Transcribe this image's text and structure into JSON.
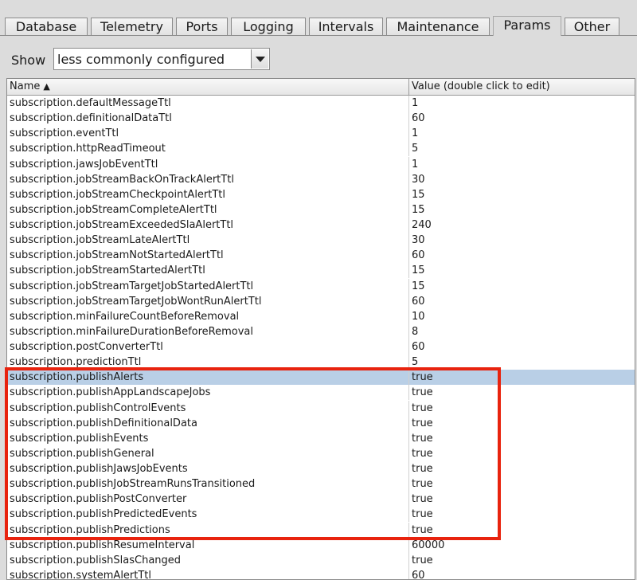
{
  "tabs": [
    {
      "label": "Database"
    },
    {
      "label": "Telemetry"
    },
    {
      "label": "Ports"
    },
    {
      "label": "Logging"
    },
    {
      "label": "Intervals"
    },
    {
      "label": "Maintenance"
    },
    {
      "label": "Params"
    },
    {
      "label": "Other"
    }
  ],
  "active_tab": "Params",
  "show": {
    "label": "Show",
    "selected": "less commonly configured"
  },
  "table": {
    "columns": {
      "name": "Name",
      "sort_indicator": "▲",
      "value": "Value (double click to edit)"
    },
    "rows": [
      {
        "name": "subscription.defaultMessageTtl",
        "value": "1"
      },
      {
        "name": "subscription.definitionalDataTtl",
        "value": "60"
      },
      {
        "name": "subscription.eventTtl",
        "value": "1"
      },
      {
        "name": "subscription.httpReadTimeout",
        "value": "5"
      },
      {
        "name": "subscription.jawsJobEventTtl",
        "value": "1"
      },
      {
        "name": "subscription.jobStreamBackOnTrackAlertTtl",
        "value": "30"
      },
      {
        "name": "subscription.jobStreamCheckpointAlertTtl",
        "value": "15"
      },
      {
        "name": "subscription.jobStreamCompleteAlertTtl",
        "value": "15"
      },
      {
        "name": "subscription.jobStreamExceededSlaAlertTtl",
        "value": "240"
      },
      {
        "name": "subscription.jobStreamLateAlertTtl",
        "value": "30"
      },
      {
        "name": "subscription.jobStreamNotStartedAlertTtl",
        "value": "60"
      },
      {
        "name": "subscription.jobStreamStartedAlertTtl",
        "value": "15"
      },
      {
        "name": "subscription.jobStreamTargetJobStartedAlertTtl",
        "value": "15"
      },
      {
        "name": "subscription.jobStreamTargetJobWontRunAlertTtl",
        "value": "60"
      },
      {
        "name": "subscription.minFailureCountBeforeRemoval",
        "value": "10"
      },
      {
        "name": "subscription.minFailureDurationBeforeRemoval",
        "value": "8"
      },
      {
        "name": "subscription.postConverterTtl",
        "value": "60"
      },
      {
        "name": "subscription.predictionTtl",
        "value": "5"
      },
      {
        "name": "subscription.publishAlerts",
        "value": "true",
        "selected": true
      },
      {
        "name": "subscription.publishAppLandscapeJobs",
        "value": "true"
      },
      {
        "name": "subscription.publishControlEvents",
        "value": "true"
      },
      {
        "name": "subscription.publishDefinitionalData",
        "value": "true"
      },
      {
        "name": "subscription.publishEvents",
        "value": "true"
      },
      {
        "name": "subscription.publishGeneral",
        "value": "true"
      },
      {
        "name": "subscription.publishJawsJobEvents",
        "value": "true"
      },
      {
        "name": "subscription.publishJobStreamRunsTransitioned",
        "value": "true"
      },
      {
        "name": "subscription.publishPostConverter",
        "value": "true"
      },
      {
        "name": "subscription.publishPredictedEvents",
        "value": "true"
      },
      {
        "name": "subscription.publishPredictions",
        "value": "true"
      },
      {
        "name": "subscription.publishResumeInterval",
        "value": "60000"
      },
      {
        "name": "subscription.publishSlasChanged",
        "value": "true"
      },
      {
        "name": "subscription.systemAlertTtl",
        "value": "60"
      }
    ]
  },
  "colors": {
    "annotation_box": "#e8230e",
    "selection": "#b9cfe6"
  }
}
